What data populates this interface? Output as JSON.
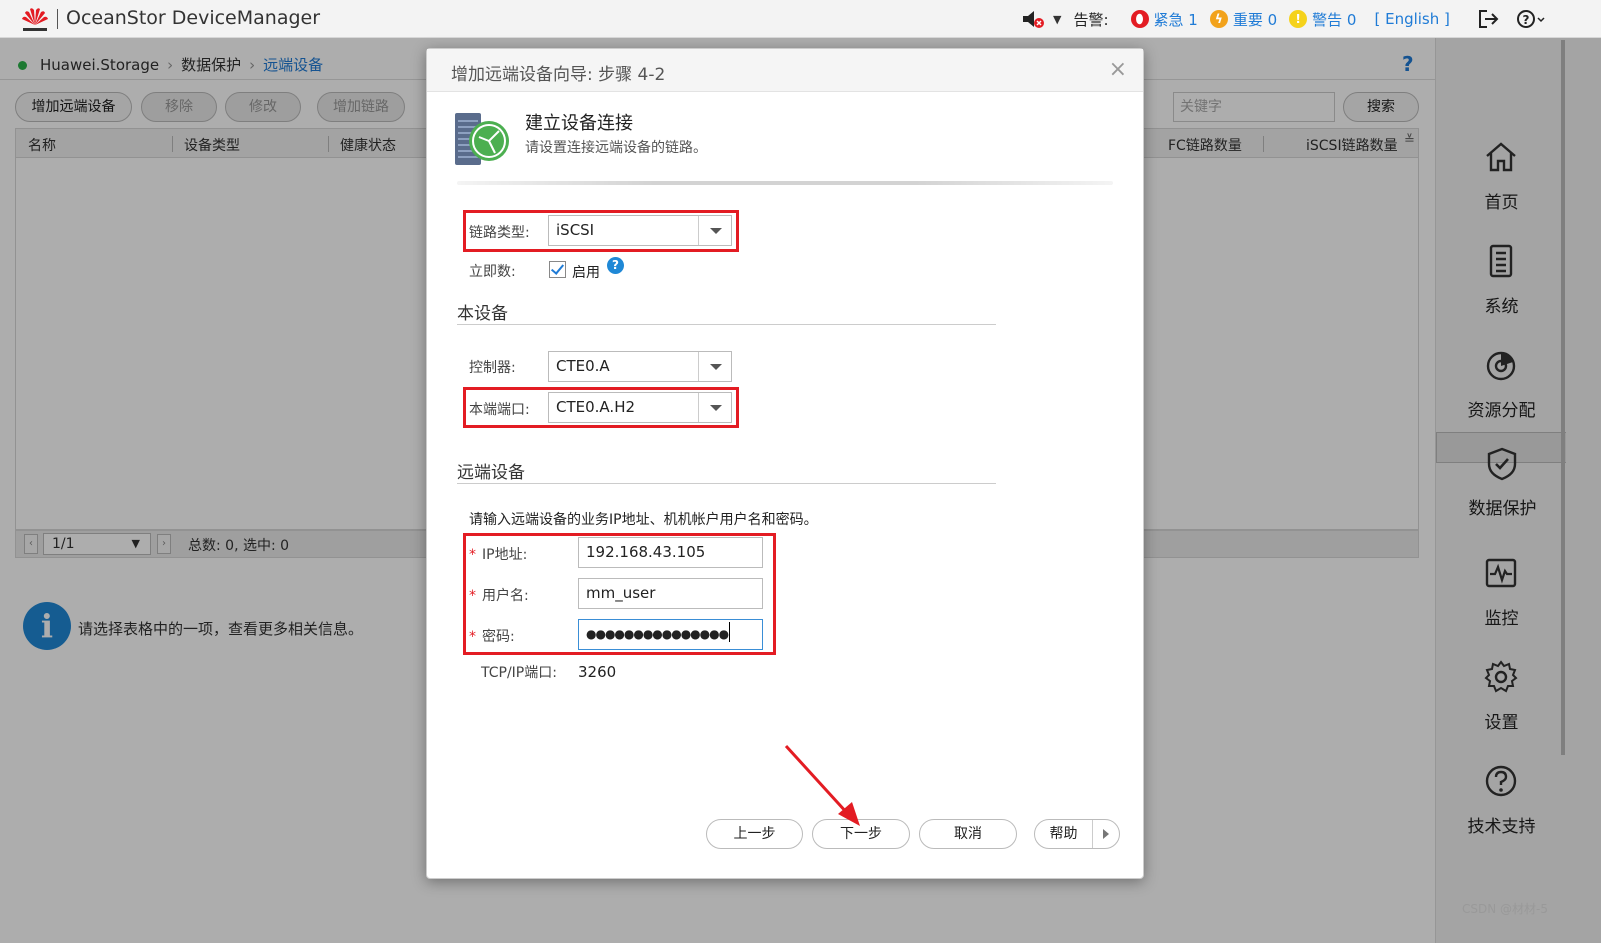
{
  "topbar": {
    "title": "OceanStor DeviceManager",
    "alarm_label": "告警:",
    "urgent": "紧急 1",
    "important": "重要 0",
    "warning": "警告 0",
    "language": "[ English ]"
  },
  "breadcrumb": {
    "root": "Huawei.Storage",
    "level1": "数据保护",
    "current": "远端设备"
  },
  "toolbar": {
    "add_remote": "增加远端设备",
    "remove": "移除",
    "modify": "修改",
    "add_link": "增加链路",
    "search_placeholder": "关键字",
    "search": "搜索"
  },
  "table": {
    "columns": [
      "名称",
      "设备类型",
      "健康状态",
      "FC链路数量",
      "iSCSI链路数量"
    ]
  },
  "pager": {
    "page": "1/1",
    "summary": "总数: 0, 选中: 0"
  },
  "info_text": "请选择表格中的一项，查看更多相关信息。",
  "nav": [
    {
      "label": "首页",
      "icon": "home-icon"
    },
    {
      "label": "系统",
      "icon": "system-icon"
    },
    {
      "label": "资源分配",
      "icon": "resource-icon"
    },
    {
      "label": "数据保护",
      "icon": "shield-icon"
    },
    {
      "label": "监控",
      "icon": "monitor-icon"
    },
    {
      "label": "设置",
      "icon": "gear-icon"
    },
    {
      "label": "技术支持",
      "icon": "support-icon"
    }
  ],
  "dialog": {
    "title": "增加远端设备向导: 步骤 4-2",
    "step_title": "建立设备连接",
    "step_desc": "请设置连接远端设备的链路。",
    "link_type_label": "链路类型:",
    "link_type_value": "iSCSI",
    "immediate_label": "立即数:",
    "enable_label": "启用",
    "local_section": "本设备",
    "controller_label": "控制器:",
    "controller_value": "CTE0.A",
    "local_port_label": "本端端口:",
    "local_port_value": "CTE0.A.H2",
    "remote_section": "远端设备",
    "remote_hint": "请输入远端设备的业务IP地址、机机帐户用户名和密码。",
    "ip_label": "IP地址:",
    "ip_value": "192.168.43.105",
    "user_label": "用户名:",
    "user_value": "mm_user",
    "pwd_label": "密码:",
    "pwd_value": "●●●●●●●●●●●●●●●",
    "tcp_label": "TCP/IP端口:",
    "tcp_value": "3260",
    "btn_prev": "上一步",
    "btn_next": "下一步",
    "btn_cancel": "取消",
    "btn_help": "帮助"
  },
  "watermark": "CSDN @材材-5",
  "colors": {
    "accent": "#1f7bd6",
    "highlight": "#e31c23",
    "ok": "#2cb34a"
  }
}
